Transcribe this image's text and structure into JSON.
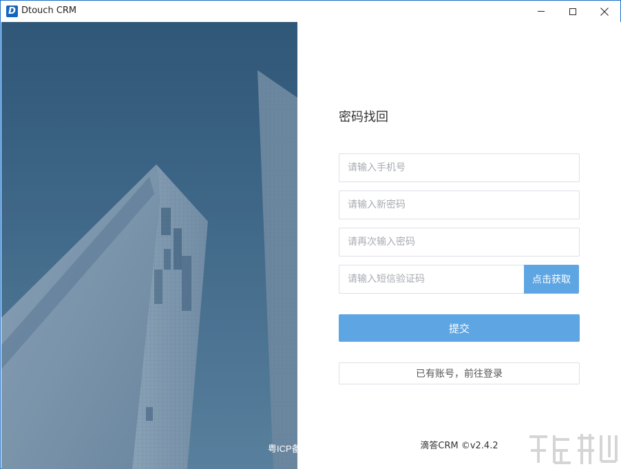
{
  "window": {
    "title": "Dtouch CRM",
    "logo_letter": "D",
    "controls": {
      "minimize_icon": "minimize-icon",
      "maximize_icon": "maximize-icon",
      "close_icon": "close-icon"
    }
  },
  "hero": {
    "image": "skyscraper-photo",
    "icp_text": "粤ICP备"
  },
  "form": {
    "title": "密码找回",
    "phone_placeholder": "请输入手机号",
    "new_password_placeholder": "请输入新密码",
    "confirm_password_placeholder": "请再次输入密码",
    "sms_code_placeholder": "请输入短信验证码",
    "get_code_label": "点击获取",
    "submit_label": "提交",
    "login_link_label": "已有账号，前往登录"
  },
  "footer": {
    "text": "滴答CRM ©v2.4.2"
  },
  "colors": {
    "accent": "#5ea6e3",
    "window_border": "#1a6fc4",
    "hero_sky": "#3c6485",
    "input_border": "#dcdfe6"
  }
}
